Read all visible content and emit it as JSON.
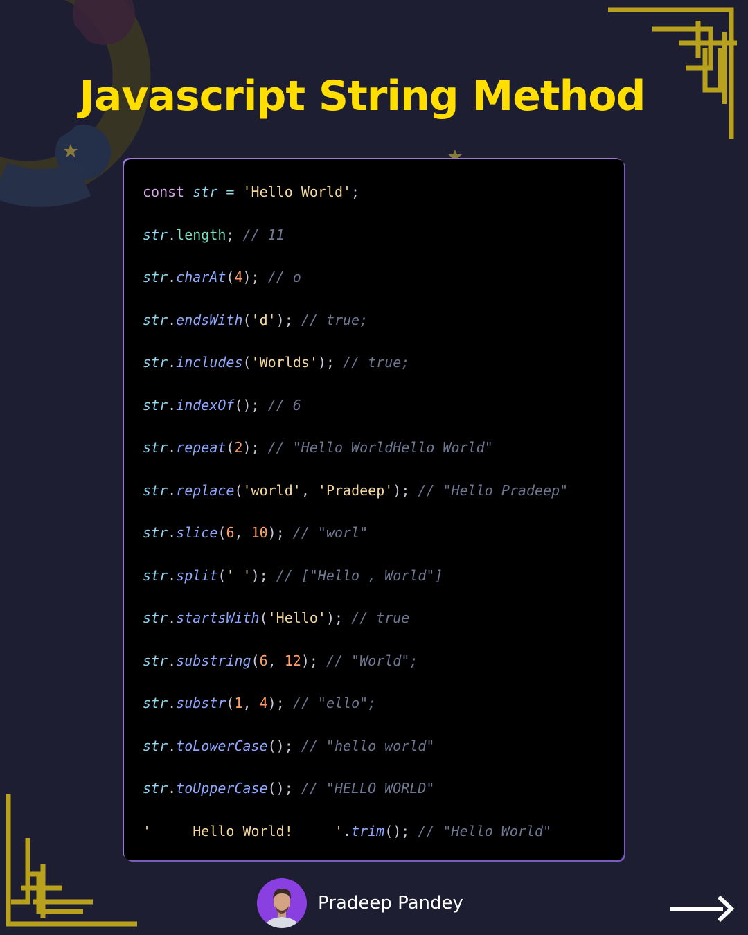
{
  "title": "Javascript String Method",
  "colors": {
    "background": "#1e1e33",
    "title": "#ffde00",
    "code_bg": "#000000",
    "gold": "#b8a11c",
    "avatar_bg": "#8a3fe0"
  },
  "code_lines": [
    [
      [
        "kw",
        "const "
      ],
      [
        "var",
        "str"
      ],
      [
        "op",
        " = "
      ],
      [
        "str",
        "'Hello World'"
      ],
      [
        "pun",
        ";"
      ]
    ],
    [
      [
        "var",
        "str"
      ],
      [
        "pun",
        "."
      ],
      [
        "prop",
        "length"
      ],
      [
        "pun",
        "; "
      ],
      [
        "cm",
        "// 11"
      ]
    ],
    [
      [
        "var",
        "str"
      ],
      [
        "pun",
        "."
      ],
      [
        "fn",
        "charAt"
      ],
      [
        "pun",
        "("
      ],
      [
        "num",
        "4"
      ],
      [
        "pun",
        "); "
      ],
      [
        "cm",
        "// o"
      ]
    ],
    [
      [
        "var",
        "str"
      ],
      [
        "pun",
        "."
      ],
      [
        "fn",
        "endsWith"
      ],
      [
        "pun",
        "("
      ],
      [
        "str",
        "'d'"
      ],
      [
        "pun",
        "); "
      ],
      [
        "cm",
        "// true;"
      ]
    ],
    [
      [
        "var",
        "str"
      ],
      [
        "pun",
        "."
      ],
      [
        "fn",
        "includes"
      ],
      [
        "pun",
        "("
      ],
      [
        "str",
        "'Worlds'"
      ],
      [
        "pun",
        "); "
      ],
      [
        "cm",
        "// true;"
      ]
    ],
    [
      [
        "var",
        "str"
      ],
      [
        "pun",
        "."
      ],
      [
        "fn",
        "indexOf"
      ],
      [
        "pun",
        "(); "
      ],
      [
        "cm",
        "// 6"
      ]
    ],
    [
      [
        "var",
        "str"
      ],
      [
        "pun",
        "."
      ],
      [
        "fn",
        "repeat"
      ],
      [
        "pun",
        "("
      ],
      [
        "num",
        "2"
      ],
      [
        "pun",
        "); "
      ],
      [
        "cm",
        "// \"Hello WorldHello World\""
      ]
    ],
    [
      [
        "var",
        "str"
      ],
      [
        "pun",
        "."
      ],
      [
        "fn",
        "replace"
      ],
      [
        "pun",
        "("
      ],
      [
        "str",
        "'world'"
      ],
      [
        "pun",
        ", "
      ],
      [
        "str",
        "'Pradeep'"
      ],
      [
        "pun",
        "); "
      ],
      [
        "cm",
        "// \"Hello Pradeep\""
      ]
    ],
    [
      [
        "var",
        "str"
      ],
      [
        "pun",
        "."
      ],
      [
        "fn",
        "slice"
      ],
      [
        "pun",
        "("
      ],
      [
        "num",
        "6"
      ],
      [
        "pun",
        ", "
      ],
      [
        "num",
        "10"
      ],
      [
        "pun",
        "); "
      ],
      [
        "cm",
        "// \"worl\""
      ]
    ],
    [
      [
        "var",
        "str"
      ],
      [
        "pun",
        "."
      ],
      [
        "fn",
        "split"
      ],
      [
        "pun",
        "("
      ],
      [
        "str",
        "' '"
      ],
      [
        "pun",
        "); "
      ],
      [
        "cm",
        "// [\"Hello , World\"]"
      ]
    ],
    [
      [
        "var",
        "str"
      ],
      [
        "pun",
        "."
      ],
      [
        "fn",
        "startsWith"
      ],
      [
        "pun",
        "("
      ],
      [
        "str",
        "'Hello'"
      ],
      [
        "pun",
        "); "
      ],
      [
        "cm",
        "// true"
      ]
    ],
    [
      [
        "var",
        "str"
      ],
      [
        "pun",
        "."
      ],
      [
        "fn",
        "substring"
      ],
      [
        "pun",
        "("
      ],
      [
        "num",
        "6"
      ],
      [
        "pun",
        ", "
      ],
      [
        "num",
        "12"
      ],
      [
        "pun",
        "); "
      ],
      [
        "cm",
        "// \"World\";"
      ]
    ],
    [
      [
        "var",
        "str"
      ],
      [
        "pun",
        "."
      ],
      [
        "fn",
        "substr"
      ],
      [
        "pun",
        "("
      ],
      [
        "num",
        "1"
      ],
      [
        "pun",
        ", "
      ],
      [
        "num",
        "4"
      ],
      [
        "pun",
        "); "
      ],
      [
        "cm",
        "// \"ello\";"
      ]
    ],
    [
      [
        "var",
        "str"
      ],
      [
        "pun",
        "."
      ],
      [
        "fn",
        "toLowerCase"
      ],
      [
        "pun",
        "(); "
      ],
      [
        "cm",
        "// \"hello world\""
      ]
    ],
    [
      [
        "var",
        "str"
      ],
      [
        "pun",
        "."
      ],
      [
        "fn",
        "toUpperCase"
      ],
      [
        "pun",
        "(); "
      ],
      [
        "cm",
        "// \"HELLO WORLD\""
      ]
    ],
    [
      [
        "str",
        "'     Hello World!     '"
      ],
      [
        "pun",
        "."
      ],
      [
        "fn",
        "trim"
      ],
      [
        "pun",
        "(); "
      ],
      [
        "cm",
        "// \"Hello World\""
      ]
    ]
  ],
  "author": {
    "name": "Pradeep Pandey"
  },
  "icons": {
    "next": "arrow-right-icon",
    "avatar": "person-avatar",
    "star": "star-icon"
  }
}
